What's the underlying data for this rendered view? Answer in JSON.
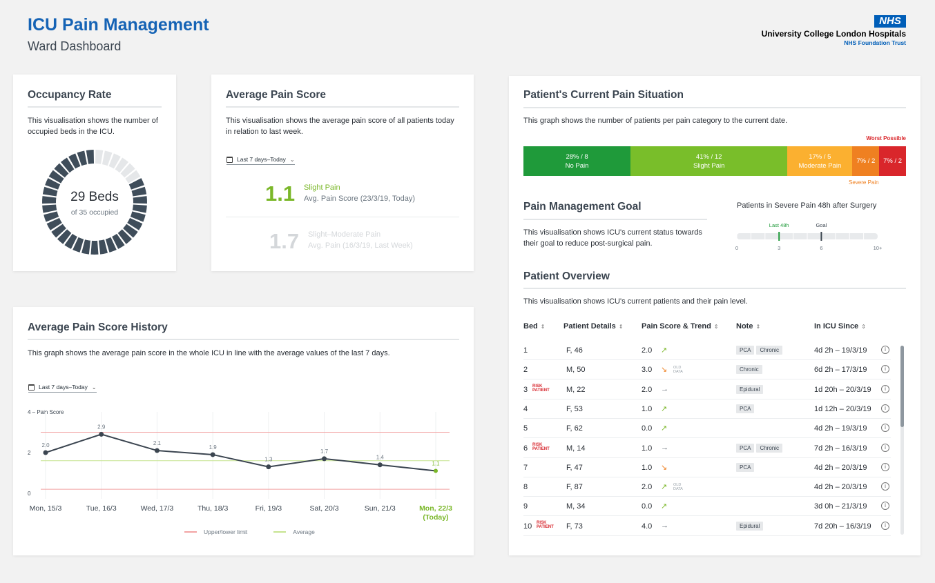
{
  "header": {
    "title": "ICU Pain Management",
    "subtitle": "Ward Dashboard",
    "nhs_badge": "NHS",
    "org_name": "University College London Hospitals",
    "org_trust": "NHS Foundation Trust"
  },
  "occupancy": {
    "title": "Occupancy Rate",
    "description": "This visualisation shows the number of occupied beds in the ICU.",
    "beds_label": "29 Beds",
    "sub_label": "of 35 occupied",
    "occupied": 29,
    "total": 35,
    "colors": {
      "occupied": "#3f4d5a",
      "empty": "#e5e7e9"
    }
  },
  "avg_pain": {
    "title": "Average Pain Score",
    "description": "This visualisation shows the average pain score of all patients today in relation to last week.",
    "dropdown": "Last 7 days–Today",
    "current": {
      "value": "1.1",
      "label": "Slight Pain",
      "desc": "Avg. Pain Score (23/3/19, Today)"
    },
    "previous": {
      "value": "1.7",
      "label": "Slight–Moderate Pain",
      "desc": "Avg. Pain (16/3/19, Last Week)"
    }
  },
  "history": {
    "title": "Average Pain Score History",
    "description": "This graph shows the average pain score in the whole ICU in line with the average values of the last 7 days.",
    "dropdown": "Last 7 days–Today",
    "legend_limit": "Upper/lower limit",
    "legend_average": "Average",
    "today_label": "(Today)",
    "colors": {
      "line": "#3b4550",
      "limit": "#f2a3a3",
      "average": "#c6e38f",
      "today": "#7ab728"
    }
  },
  "chart_data": {
    "type": "line",
    "x": [
      "Mon, 15/3",
      "Tue, 16/3",
      "Wed, 17/3",
      "Thu, 18/3",
      "Fri, 19/3",
      "Sat, 20/3",
      "Sun, 21/3",
      "Mon, 22/3"
    ],
    "y_tick_labels": [
      "4 – Pain Score",
      "2",
      "0"
    ],
    "ylim": [
      0,
      4
    ],
    "series": [
      {
        "values": [
          2.0,
          2.9,
          2.1,
          1.9,
          1.3,
          1.7,
          1.4,
          1.1
        ],
        "labels": [
          "2.0",
          "2.9",
          "2.1",
          "1.9",
          "1.3",
          "1.7",
          "1.4",
          "1.1"
        ]
      }
    ],
    "upper_limit": 3.0,
    "lower_limit": 0.2,
    "average": 1.6
  },
  "situation": {
    "title": "Patient's Current Pain Situation",
    "description": "This graph shows the number of patients per pain category to the current date.",
    "worst_label": "Worst Possible",
    "severe_label": "Severe Pain",
    "segments": [
      {
        "label": "No Pain",
        "value": "28% / 8",
        "fraction": 0.28,
        "color": "#1f9a3a"
      },
      {
        "label": "Slight Pain",
        "value": "41% / 12",
        "fraction": 0.41,
        "color": "#79be2a"
      },
      {
        "label": "Moderate Pain",
        "value": "17% / 5",
        "fraction": 0.17,
        "color": "#fbb030"
      },
      {
        "label": "",
        "value": "7% / 2",
        "fraction": 0.07,
        "color": "#ef8021"
      },
      {
        "label": "",
        "value": "7% / 2",
        "fraction": 0.07,
        "color": "#d9262b"
      }
    ]
  },
  "goal": {
    "title": "Pain Management Goal",
    "description": "This visualisation shows ICU's current status towards their goal to reduce post-surgical pain.",
    "chart_title": "Patients in Severe Pain 48h after Surgery",
    "last48_label": "Last 48h",
    "goal_label": "Goal",
    "current_value": 3,
    "goal_value": 6,
    "max_value": 10,
    "ticks": [
      "0",
      "3",
      "6",
      "10+"
    ]
  },
  "overview": {
    "title": "Patient Overview",
    "description": "This visualisation shows ICU's current patients and their pain level.",
    "columns": [
      "Bed",
      "Patient Details",
      "Pain Score & Trend",
      "Note",
      "In ICU Since"
    ],
    "risk_label": [
      "RISK",
      "PATIENT"
    ],
    "old_label": [
      "OLD",
      "DATA"
    ],
    "rows": [
      {
        "bed": "1",
        "risk": false,
        "patient": "F, 46",
        "score": "2.0",
        "trend": "up",
        "old": false,
        "notes": [
          "PCA",
          "Chronic"
        ],
        "since": "4d 2h – 19/3/19"
      },
      {
        "bed": "2",
        "risk": false,
        "patient": "M, 50",
        "score": "3.0",
        "trend": "down",
        "old": true,
        "notes": [
          "Chronic"
        ],
        "since": "6d 2h – 17/3/19"
      },
      {
        "bed": "3",
        "risk": true,
        "patient": "M, 22",
        "score": "2.0",
        "trend": "flat",
        "old": false,
        "notes": [
          "Epidural"
        ],
        "since": "1d 20h – 20/3/19"
      },
      {
        "bed": "4",
        "risk": false,
        "patient": "F, 53",
        "score": "1.0",
        "trend": "up",
        "old": false,
        "notes": [
          "PCA"
        ],
        "since": "1d 12h – 20/3/19"
      },
      {
        "bed": "5",
        "risk": false,
        "patient": "F, 62",
        "score": "0.0",
        "trend": "up",
        "old": false,
        "notes": [],
        "since": "4d 2h – 19/3/19"
      },
      {
        "bed": "6",
        "risk": true,
        "patient": "M, 14",
        "score": "1.0",
        "trend": "flat",
        "old": false,
        "notes": [
          "PCA",
          "Chronic"
        ],
        "since": "7d 2h – 16/3/19"
      },
      {
        "bed": "7",
        "risk": false,
        "patient": "F, 47",
        "score": "1.0",
        "trend": "down",
        "old": false,
        "notes": [
          "PCA"
        ],
        "since": "4d 2h – 20/3/19"
      },
      {
        "bed": "8",
        "risk": false,
        "patient": "F, 87",
        "score": "2.0",
        "trend": "up",
        "old": true,
        "notes": [],
        "since": "4d 2h – 20/3/19"
      },
      {
        "bed": "9",
        "risk": false,
        "patient": "M, 34",
        "score": "0.0",
        "trend": "up",
        "old": false,
        "notes": [],
        "since": "3d 0h – 21/3/19"
      },
      {
        "bed": "10",
        "risk": true,
        "patient": "F, 73",
        "score": "4.0",
        "trend": "flat",
        "old": false,
        "notes": [
          "Epidural"
        ],
        "since": "7d 20h – 16/3/19"
      }
    ],
    "trend_colors": {
      "up": "#7ab728",
      "down": "#ef8021",
      "flat": "#555f68"
    },
    "trend_glyphs": {
      "up": "↗",
      "down": "↘",
      "flat": "→"
    }
  }
}
